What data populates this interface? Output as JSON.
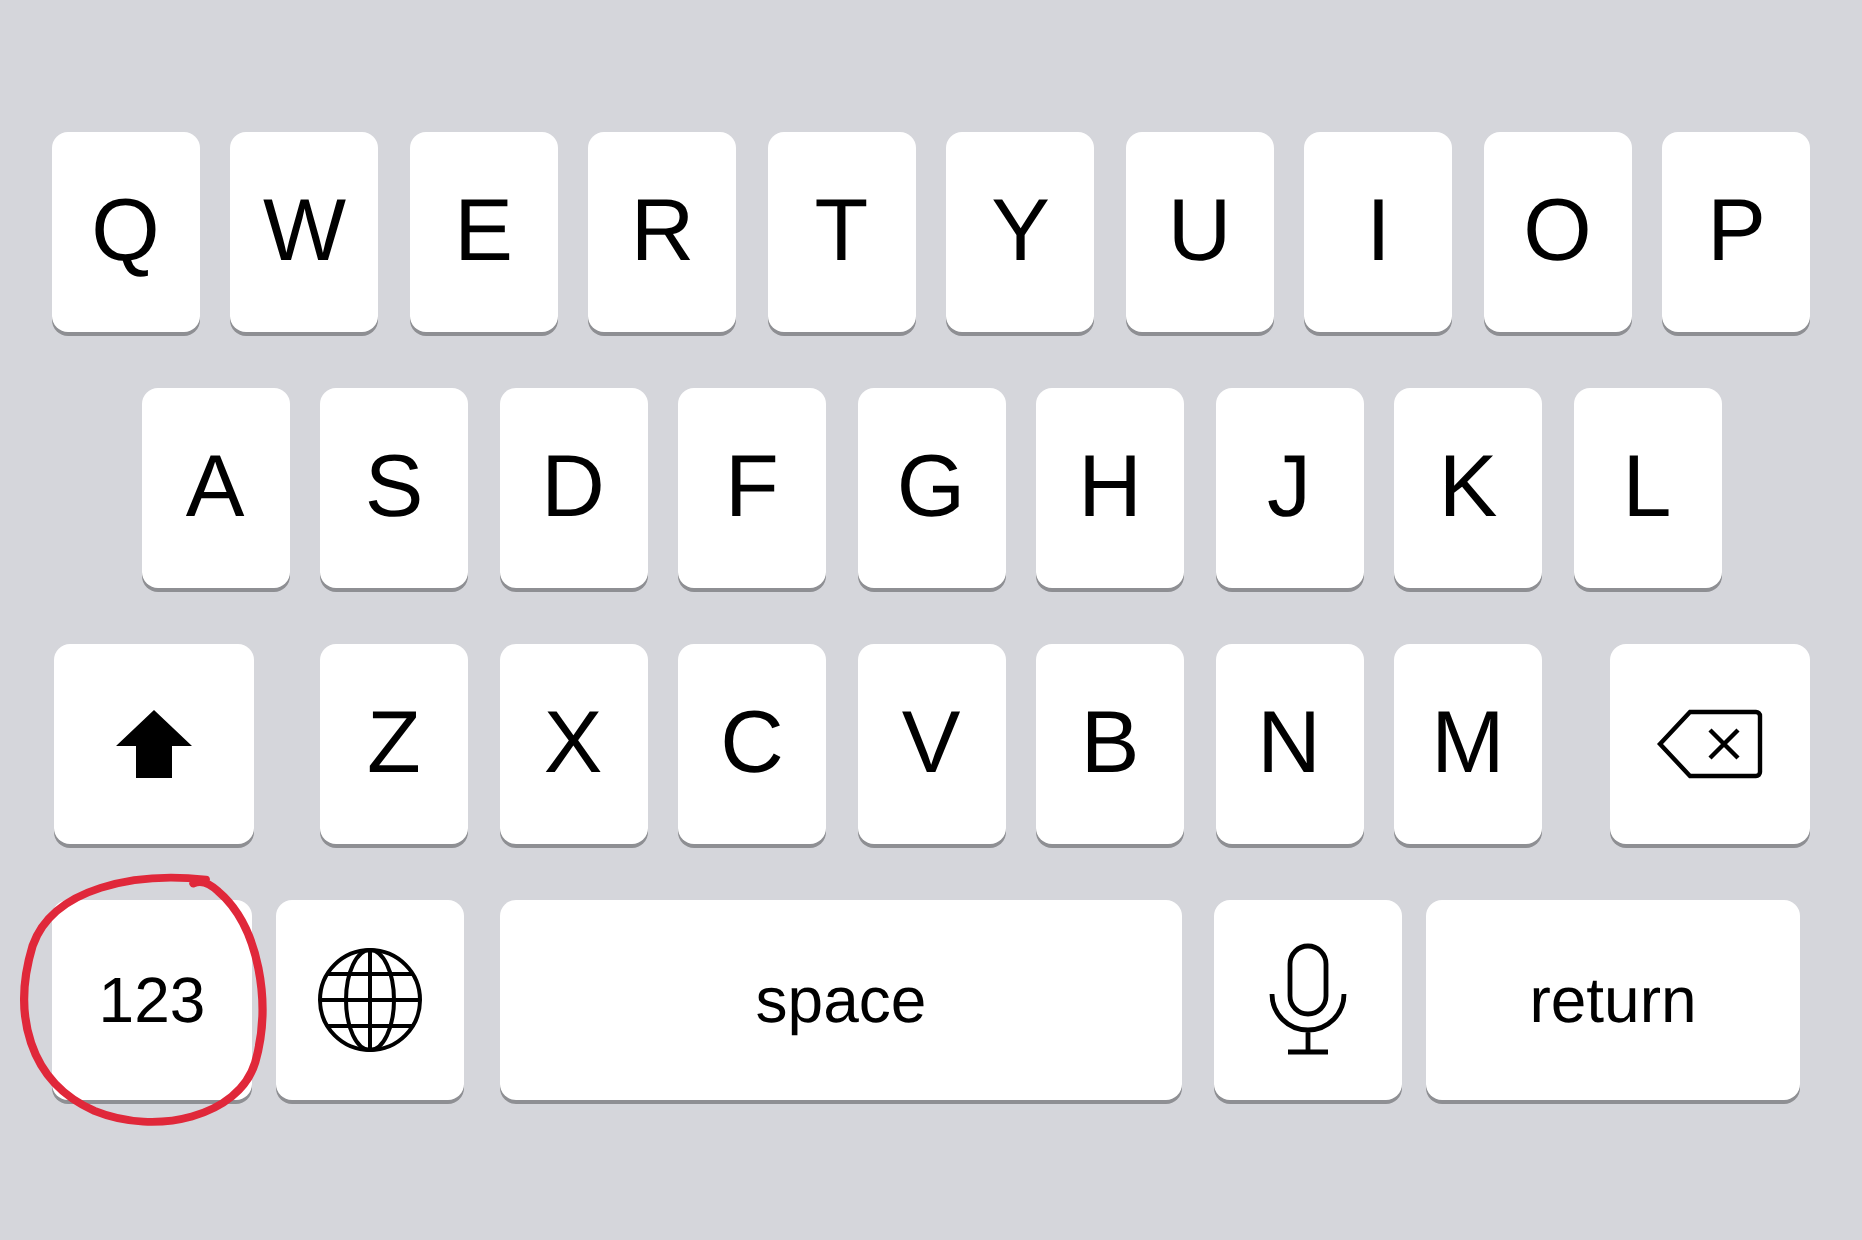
{
  "keyboard": {
    "rows": [
      {
        "keys": [
          {
            "kind": "letter",
            "label": "Q"
          },
          {
            "kind": "letter",
            "label": "W"
          },
          {
            "kind": "letter",
            "label": "E"
          },
          {
            "kind": "letter",
            "label": "R"
          },
          {
            "kind": "letter",
            "label": "T"
          },
          {
            "kind": "letter",
            "label": "Y"
          },
          {
            "kind": "letter",
            "label": "U"
          },
          {
            "kind": "letter",
            "label": "I"
          },
          {
            "kind": "letter",
            "label": "O"
          },
          {
            "kind": "letter",
            "label": "P"
          }
        ]
      },
      {
        "keys": [
          {
            "kind": "letter",
            "label": "A"
          },
          {
            "kind": "letter",
            "label": "S"
          },
          {
            "kind": "letter",
            "label": "D"
          },
          {
            "kind": "letter",
            "label": "F"
          },
          {
            "kind": "letter",
            "label": "G"
          },
          {
            "kind": "letter",
            "label": "H"
          },
          {
            "kind": "letter",
            "label": "J"
          },
          {
            "kind": "letter",
            "label": "K"
          },
          {
            "kind": "letter",
            "label": "L"
          }
        ]
      },
      {
        "keys": [
          {
            "kind": "shift"
          },
          {
            "kind": "letter",
            "label": "Z"
          },
          {
            "kind": "letter",
            "label": "X"
          },
          {
            "kind": "letter",
            "label": "C"
          },
          {
            "kind": "letter",
            "label": "V"
          },
          {
            "kind": "letter",
            "label": "B"
          },
          {
            "kind": "letter",
            "label": "N"
          },
          {
            "kind": "letter",
            "label": "M"
          },
          {
            "kind": "backspace"
          }
        ]
      },
      {
        "keys": [
          {
            "kind": "numbers",
            "label": "123",
            "circled": true
          },
          {
            "kind": "globe"
          },
          {
            "kind": "space",
            "label": "space"
          },
          {
            "kind": "mic"
          },
          {
            "kind": "return",
            "label": "return"
          }
        ]
      }
    ]
  }
}
